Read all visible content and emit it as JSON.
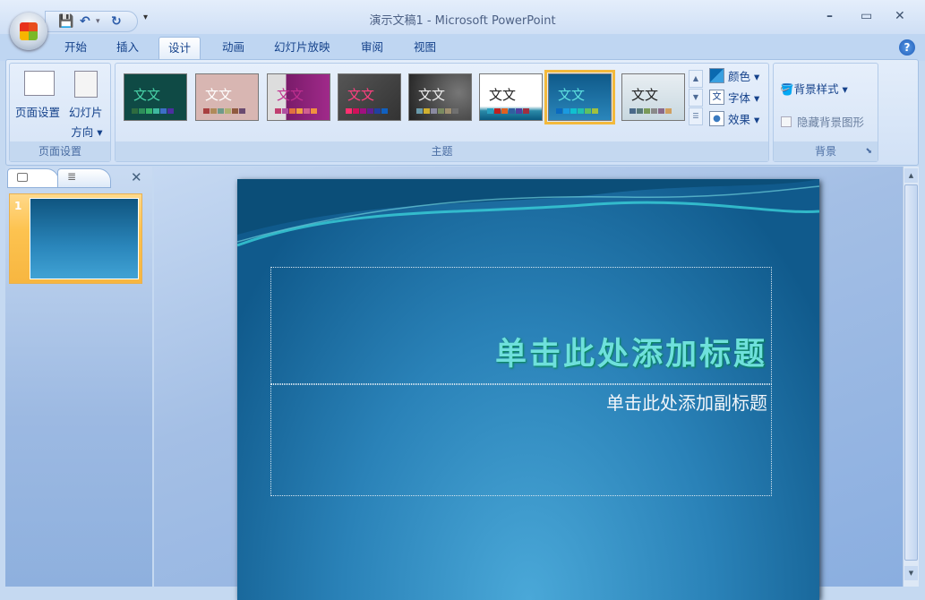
{
  "window": {
    "title": "演示文稿1 - Microsoft PowerPoint",
    "minimize": "–",
    "maximize": "▭",
    "close": "✕"
  },
  "qat": {
    "save": "💾",
    "undo": "↶",
    "undo_drop": "▾",
    "redo": "↻",
    "customize": "▾"
  },
  "tabs": [
    "开始",
    "插入",
    "设计",
    "动画",
    "幻灯片放映",
    "审阅",
    "视图"
  ],
  "active_tab": "设计",
  "help": "?",
  "page_setup_group": {
    "label": "页面设置",
    "page_setup": "页面设置",
    "orientation_line1": "幻灯片",
    "orientation_line2": "方向 ▾"
  },
  "themes_group": {
    "label": "主题",
    "themes": [
      {
        "text": "文文",
        "bg": "#0f4a45",
        "fg": "#49d3a8",
        "sw": [
          "#2e6b3f",
          "#2d8f5a",
          "#36b36a",
          "#3fb8a0",
          "#3c6fc7",
          "#4b2fa0"
        ]
      },
      {
        "text": "文文",
        "bg": "#d8b6b2",
        "fg": "#ffffff",
        "sw": [
          "#a84040",
          "#b08a5a",
          "#6f9a8a",
          "#b0b070",
          "#905a40",
          "#6a4a70"
        ]
      },
      {
        "text": "文文",
        "bg": "linear-gradient(90deg,#ddd 30%,#7a1b6a 30%,#a02a8a)",
        "fg": "#c03090",
        "sw": [
          "#c04070",
          "#b050a0",
          "#e07040",
          "#f0a040",
          "#d06090",
          "#f09040"
        ]
      },
      {
        "text": "文文",
        "bg": "linear-gradient(135deg,#555,#333)",
        "fg": "#ff4080",
        "sw": [
          "#ff3070",
          "#d0105a",
          "#a01080",
          "#602090",
          "#2040a0",
          "#1060c0"
        ]
      },
      {
        "text": "文文",
        "bg": "radial-gradient(circle at 80% 40%,#777,#222)",
        "fg": "#eeeeee",
        "sw": [
          "#6a9aaa",
          "#d0b030",
          "#8a8aa0",
          "#7a8a60",
          "#a09070",
          "#707070"
        ]
      },
      {
        "text": "文文",
        "bg": "linear-gradient(#fff 70%,#2a8aa8 80%,#0a5a80)",
        "fg": "#222222",
        "sw": [
          "#2aa0c0",
          "#c02020",
          "#e06020",
          "#3060a0",
          "#5040a0",
          "#a03040"
        ]
      },
      {
        "text": "文文",
        "bg": "linear-gradient(#0f5a8a,#2a86bb)",
        "fg": "#5fe0e0",
        "sw": [
          "#0a6ac0",
          "#1a9ae0",
          "#10c0d0",
          "#20c0b0",
          "#60c060",
          "#a0c040"
        ]
      },
      {
        "text": "文文",
        "bg": "linear-gradient(#e8eef2,#c8d8e0)",
        "fg": "#222222",
        "sw": [
          "#4a6a8a",
          "#5a7a7a",
          "#7a9a5a",
          "#8a8a8a",
          "#8a6a8a",
          "#d0a060"
        ]
      }
    ],
    "selected": 6,
    "colors": "颜色 ▾",
    "fonts": "字体 ▾",
    "effects": "效果 ▾"
  },
  "background_group": {
    "label": "背景",
    "styles": "背景样式 ▾",
    "hide": "隐藏背景图形"
  },
  "slides_panel": {
    "close": "✕",
    "slide_number": "1"
  },
  "slide": {
    "title": "单击此处添加标题",
    "subtitle": "单击此处添加副标题"
  }
}
